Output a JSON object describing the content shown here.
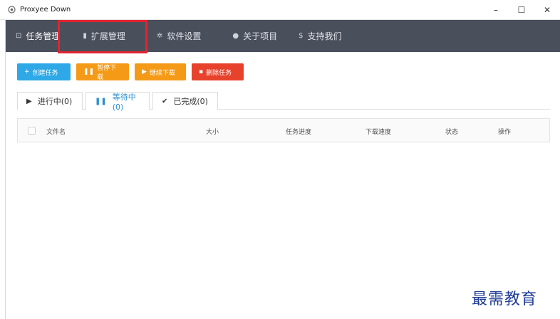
{
  "window": {
    "title": "Proxyee Down",
    "controls": {
      "minimize": "–",
      "maximize": "☐",
      "close": "✕"
    }
  },
  "nav": {
    "items": [
      {
        "label": "任务管理",
        "icon": "download-box-icon"
      },
      {
        "label": "扩展管理",
        "icon": "extension-icon"
      },
      {
        "label": "软件设置",
        "icon": "gear-icon"
      },
      {
        "label": "关于项目",
        "icon": "info-icon"
      },
      {
        "label": "支持我们",
        "icon": "dollar-icon"
      }
    ]
  },
  "actions": {
    "create": "创建任务",
    "pause": "暂停下载",
    "resume": "继续下载",
    "delete": "删除任务"
  },
  "tabs": [
    {
      "label": "进行中(0)"
    },
    {
      "label": "等待中(0)"
    },
    {
      "label": "已完成(0)"
    }
  ],
  "table": {
    "columns": [
      "文件名",
      "大小",
      "任务进度",
      "下载速度",
      "状态",
      "操作"
    ]
  },
  "watermark": "最需教育",
  "colors": {
    "nav_bg": "#4a4f5c",
    "highlight": "#e5232e",
    "create": "#2ea8e6",
    "pause": "#f49a17",
    "delete": "#e7432c",
    "active_tab": "#2a8fd3"
  }
}
